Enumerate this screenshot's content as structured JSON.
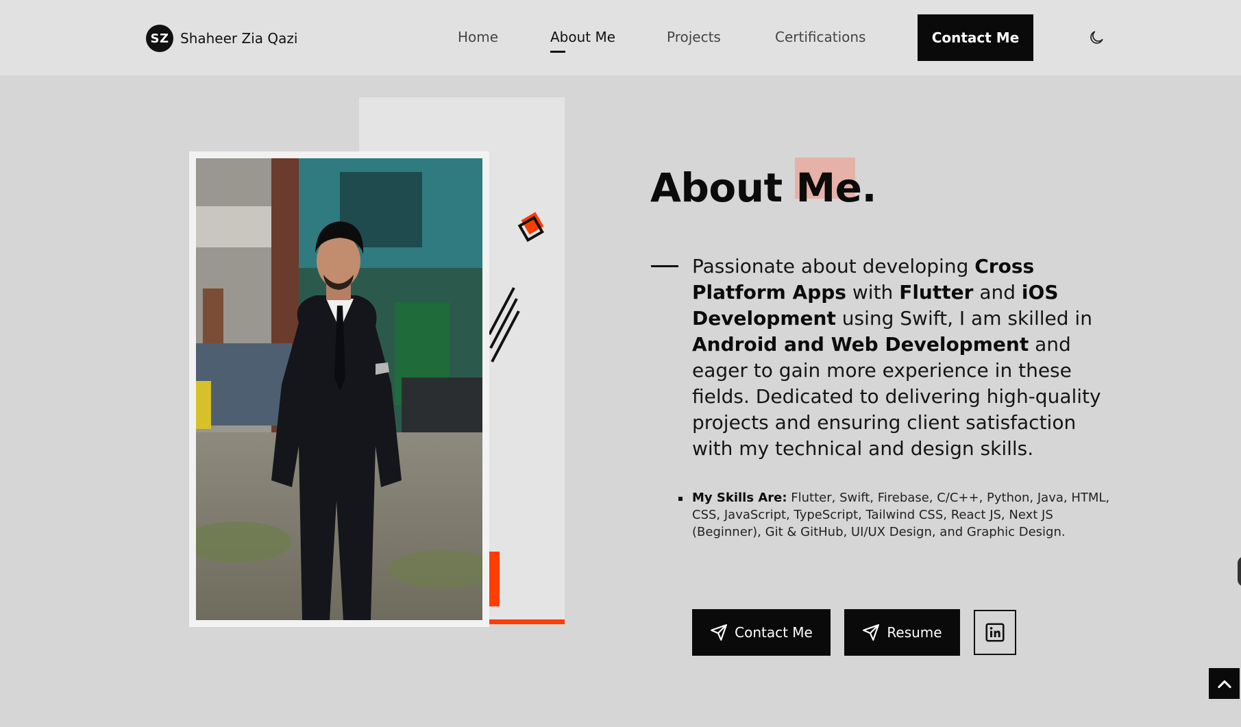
{
  "header": {
    "logo_initials": "SZ",
    "logo_name": "Shaheer Zia Qazi",
    "nav": [
      {
        "label": "Home",
        "active": false
      },
      {
        "label": "About Me",
        "active": true
      },
      {
        "label": "Projects",
        "active": false
      },
      {
        "label": "Certifications",
        "active": false
      }
    ],
    "contact_label": "Contact Me",
    "theme_icon": "moon-icon"
  },
  "about": {
    "title": "About Me.",
    "bio": [
      {
        "t": "Passionate about developing ",
        "b": false
      },
      {
        "t": "Cross Platform Apps",
        "b": true
      },
      {
        "t": " with ",
        "b": false
      },
      {
        "t": "Flutter",
        "b": true
      },
      {
        "t": " and ",
        "b": false
      },
      {
        "t": "iOS Development",
        "b": true
      },
      {
        "t": " using Swift, I am skilled in ",
        "b": false
      },
      {
        "t": "Android and Web Development",
        "b": true
      },
      {
        "t": " and eager to gain more experience in these fields. Dedicated to delivering high-quality projects and ensuring client satisfaction with my technical and design skills.",
        "b": false
      }
    ],
    "skills_label": "My Skills Are:",
    "skills_text": " Flutter, Swift, Firebase, C/C++, Python, Java, HTML, CSS, JavaScript, TypeScript, Tailwind CSS, React JS, Next JS (Beginner), Git & GitHub, UI/UX Design, and Graphic Design.",
    "buttons": {
      "contact_label": "Contact Me",
      "resume_label": "Resume",
      "contact_icon": "send-icon",
      "resume_icon": "send-icon",
      "linkedin_icon": "linkedin-icon"
    }
  },
  "scroll_top_icon": "chevron-up-icon",
  "colors": {
    "accent": "#ff3d00",
    "title_highlight": "#e6b2a7",
    "page_bg": "#d6d6d6",
    "header_bg": "#e1e1e1",
    "button_bg": "#0a0a0a"
  }
}
